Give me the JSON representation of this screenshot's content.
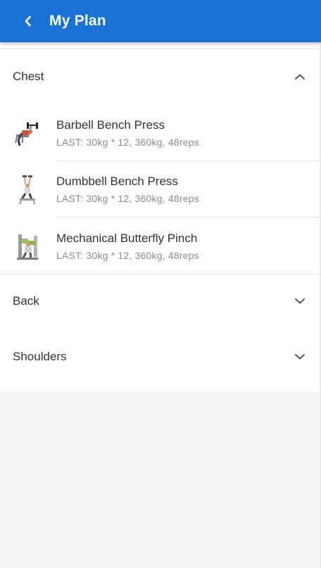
{
  "appbar": {
    "title": "My Plan",
    "back_icon": "chevron-left-icon",
    "color": "#1a72d6"
  },
  "groups": [
    {
      "label": "Chest",
      "expanded": true,
      "toggle_icon": "chevron-up-icon",
      "exercises": [
        {
          "name": "Barbell Bench Press",
          "last": "LAST: 30kg * 12, 360kg, 48reps",
          "icon": "barbell-bench-press-icon"
        },
        {
          "name": "Dumbbell Bench Press",
          "last": "LAST: 30kg * 12, 360kg, 48reps",
          "icon": "dumbbell-bench-press-icon"
        },
        {
          "name": "Mechanical Butterfly Pinch",
          "last": "LAST: 30kg * 12, 360kg, 48reps",
          "icon": "butterfly-machine-icon"
        }
      ]
    },
    {
      "label": "Back",
      "expanded": false,
      "toggle_icon": "chevron-down-icon"
    },
    {
      "label": "Shoulders",
      "expanded": false,
      "toggle_icon": "chevron-down-icon"
    }
  ]
}
